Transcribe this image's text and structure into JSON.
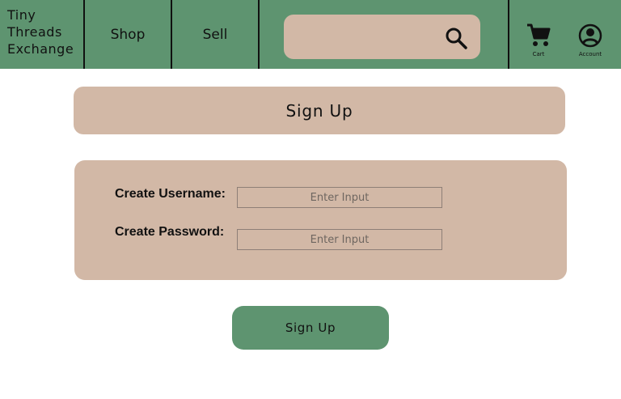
{
  "header": {
    "brand_lines": [
      "Tiny",
      "Threads",
      "Exchange"
    ],
    "nav": {
      "shop_label": "Shop",
      "sell_label": "Sell"
    },
    "search": {
      "value": "",
      "placeholder": ""
    },
    "cart_label": "Cart",
    "account_label": "Account"
  },
  "page": {
    "title": "Sign Up"
  },
  "form": {
    "username_label": "Create Username:",
    "username_placeholder": "Enter Input",
    "password_label": "Create Password:",
    "password_placeholder": "Enter Input",
    "submit_label": "Sign Up"
  },
  "colors": {
    "nav_green": "#5e9470",
    "card_tan": "#d2b8a6"
  },
  "icons": [
    "search-icon",
    "cart-icon",
    "account-icon"
  ]
}
